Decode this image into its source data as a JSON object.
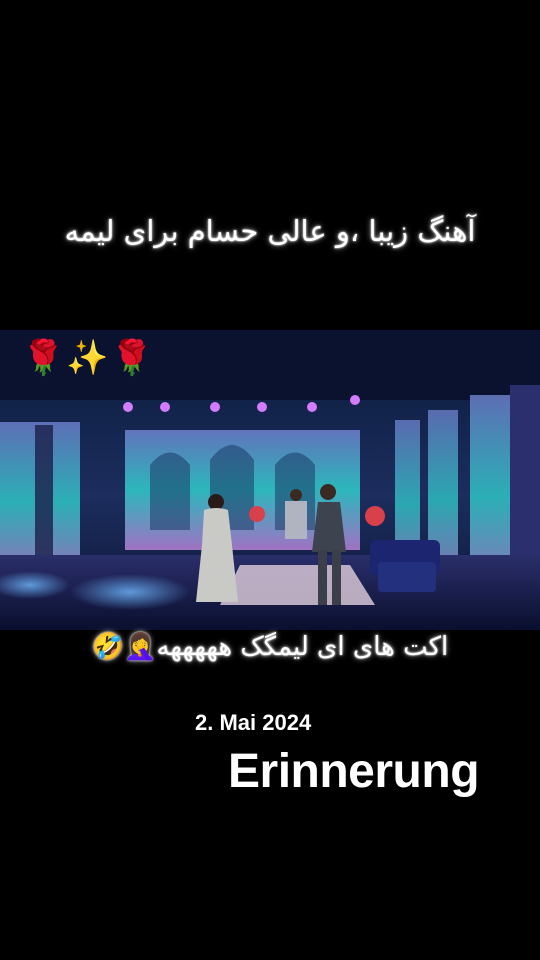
{
  "caption_top": "آهنگ زیبا ،و عالی حسام برای لیمه",
  "caption_bottom": "اکت های ای لیمگک هههههه🤦‍♀️🤣",
  "video": {
    "emoji_overlay": "🌹✨🌹"
  },
  "memory": {
    "date": "2. Mai 2024",
    "title": "Erinnerung"
  }
}
